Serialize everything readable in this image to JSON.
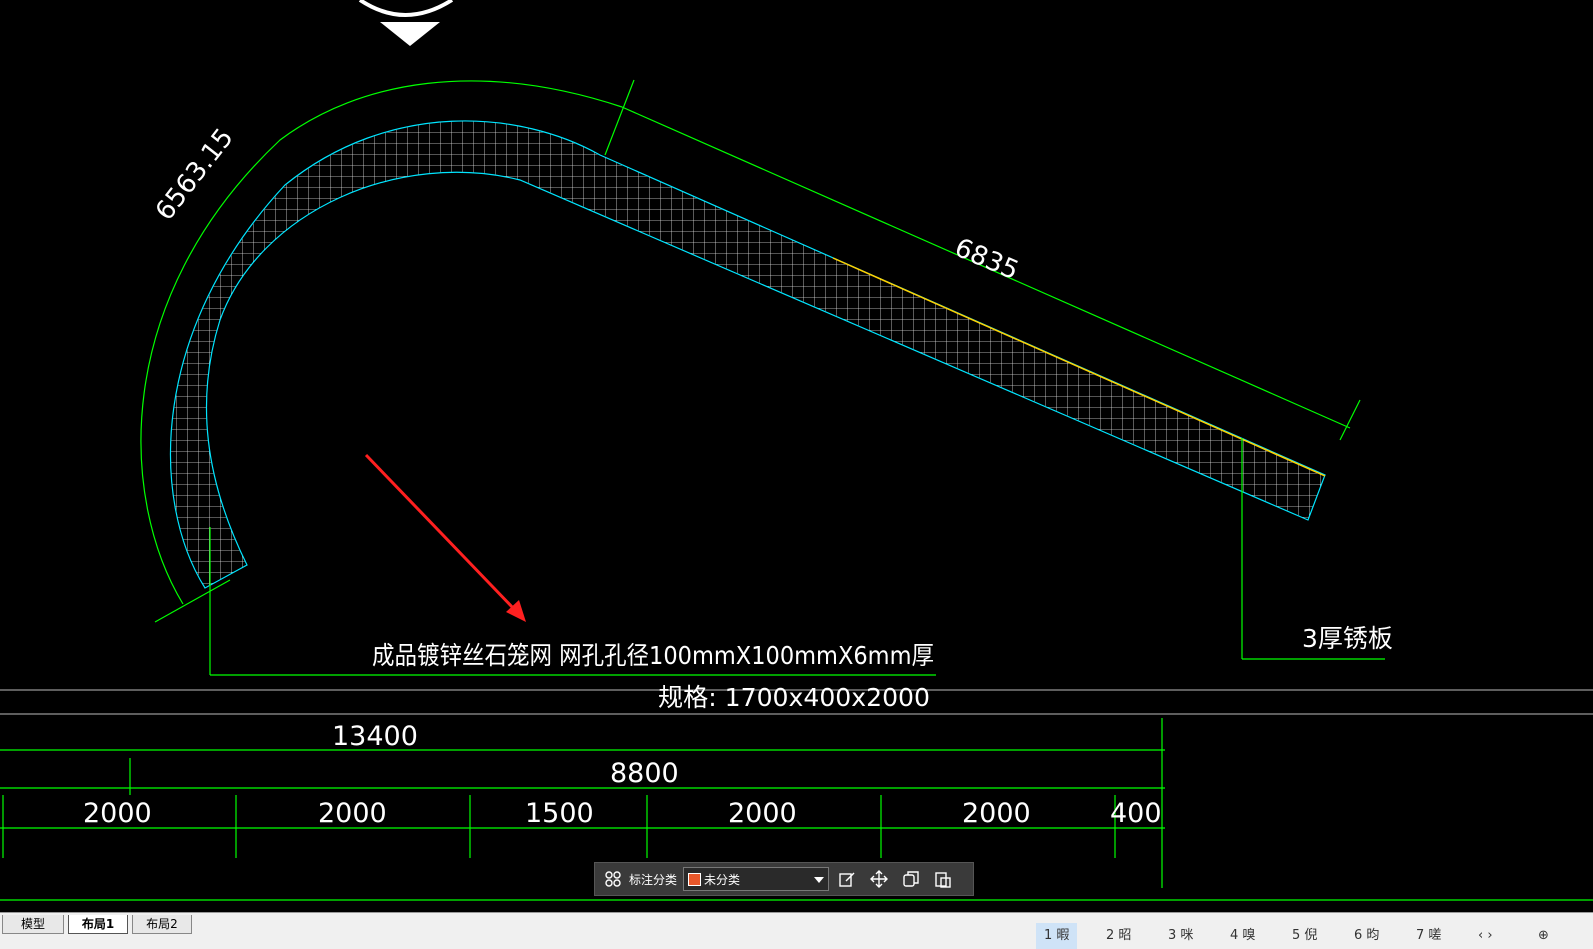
{
  "drawing": {
    "dim_arc_length": "6563.15",
    "dim_slope_length": "6835",
    "note_gabion": "成品镀锌丝石笼网  网孔孔径100mmX100mmX6mm厚",
    "note_spec": "规格: 1700x400x2000",
    "note_plate": "3厚锈板",
    "dim_total": "13400",
    "dim_sub": "8800",
    "dim_segments": [
      "2000",
      "2000",
      "1500",
      "2000",
      "2000",
      "400"
    ]
  },
  "colors": {
    "dimension_line": "#00ff00",
    "hatch": "#00e5ff",
    "plate": "#ffd000",
    "arrow": "#ff2020",
    "text": "#ffffff",
    "category_swatch": "#e8572a"
  },
  "toolbar": {
    "label": "标注分类",
    "selected_category": "未分类",
    "icons": [
      "grid-icon",
      "edit-icon",
      "move-icon",
      "copy-icon",
      "paste-icon"
    ]
  },
  "tabs": {
    "layout_tabs": [
      "模型",
      "布局1",
      "布局2"
    ],
    "active": "布局1",
    "page_tabs": [
      "1 暇",
      "2 昭",
      "3 咪",
      "4 嗅",
      "5 倪",
      "6 昀",
      "7 嗟"
    ]
  }
}
